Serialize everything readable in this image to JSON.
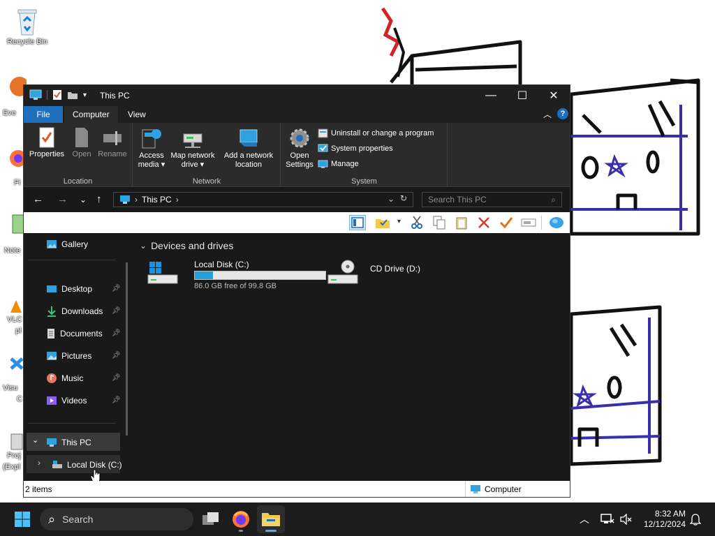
{
  "desktop": {
    "icons": [
      {
        "label": "Recycle Bin"
      },
      {
        "label": "Eve"
      },
      {
        "label": "Fi"
      },
      {
        "label": "Note"
      },
      {
        "label": "VLC"
      },
      {
        "label": "pl"
      },
      {
        "label": "Visu"
      },
      {
        "label": "C"
      },
      {
        "label": "Proj"
      },
      {
        "label": "(Expl"
      }
    ]
  },
  "window": {
    "title": "This PC",
    "controls": {
      "minimize": "—",
      "maximize": "☐",
      "close": "✕"
    },
    "tabs": [
      "File",
      "Computer",
      "View"
    ],
    "active_tab": "Computer",
    "ribbon": {
      "groups": [
        {
          "label": "Location",
          "buttons": [
            "Properties",
            "Open",
            "Rename"
          ]
        },
        {
          "label": "Network",
          "buttons": [
            {
              "line1": "Access",
              "line2": "media ▾"
            },
            {
              "line1": "Map network",
              "line2": "drive ▾"
            },
            {
              "line1": "Add a network",
              "line2": "location"
            }
          ]
        },
        {
          "label": "System",
          "open_settings": {
            "line1": "Open",
            "line2": "Settings"
          },
          "small_buttons": [
            "Uninstall or change a program",
            "System properties",
            "Manage"
          ]
        }
      ]
    },
    "address": {
      "path": "This PC",
      "search_placeholder": "Search This PC"
    },
    "nav": {
      "quick_access": [
        {
          "label": "Gallery"
        },
        {
          "label": "Desktop",
          "pinned": true
        },
        {
          "label": "Downloads",
          "pinned": true
        },
        {
          "label": "Documents",
          "pinned": true
        },
        {
          "label": "Pictures",
          "pinned": true
        },
        {
          "label": "Music",
          "pinned": true
        },
        {
          "label": "Videos",
          "pinned": true
        }
      ],
      "this_pc": "This PC",
      "local_disk": "Local Disk (C:)"
    },
    "content": {
      "section": "Devices and drives",
      "drives": [
        {
          "name": "Local Disk (C:)",
          "free_text": "86.0 GB free of 99.8 GB",
          "used_fraction": 0.138
        },
        {
          "name": "CD Drive (D:)"
        }
      ]
    },
    "status": {
      "items": "2 items",
      "location": "Computer"
    }
  },
  "taskbar": {
    "search_label": "Search",
    "time": "8:32 AM",
    "date": "12/12/2024"
  },
  "colors": {
    "accent": "#1f6fbf",
    "window_bg": "#191919",
    "ribbon_bg": "#2b2b2b",
    "bar_fill": "#26a0da"
  }
}
